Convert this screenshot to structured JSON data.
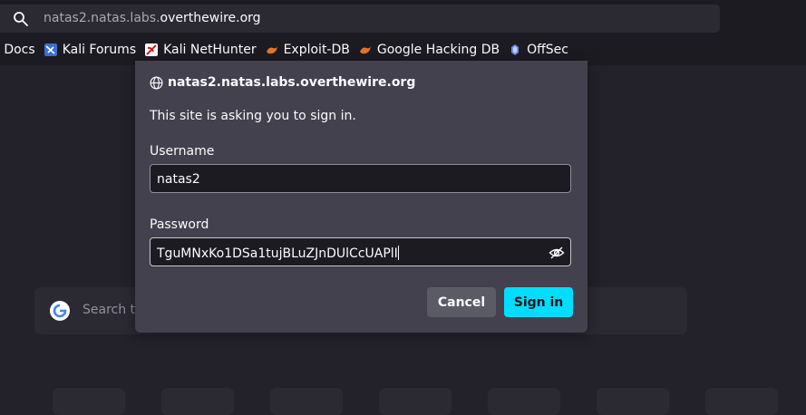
{
  "address_bar": {
    "url_prefix": "natas2.natas.labs.",
    "url_domain": "overthewire.org"
  },
  "bookmarks": [
    {
      "label": "i Docs",
      "icon": "kali-docs-icon"
    },
    {
      "label": "Kali Forums",
      "icon": "kali-forums-icon"
    },
    {
      "label": "Kali NetHunter",
      "icon": "kali-nethunter-icon"
    },
    {
      "label": "Exploit-DB",
      "icon": "exploit-db-icon"
    },
    {
      "label": "Google Hacking DB",
      "icon": "google-hacking-db-icon"
    },
    {
      "label": "OffSec",
      "icon": "offsec-icon"
    }
  ],
  "new_tab": {
    "search_placeholder": "Search t"
  },
  "auth_dialog": {
    "origin": "natas2.natas.labs.overthewire.org",
    "message": "This site is asking you to sign in.",
    "username_label": "Username",
    "username_value": "natas2",
    "password_label": "Password",
    "password_value": "TguMNxKo1DSa1tujBLuZJnDUlCcUAPlI",
    "cancel_label": "Cancel",
    "signin_label": "Sign in"
  },
  "colors": {
    "accent": "#00ddff",
    "dialog_bg": "#42414d",
    "page_bg": "#23222b"
  }
}
